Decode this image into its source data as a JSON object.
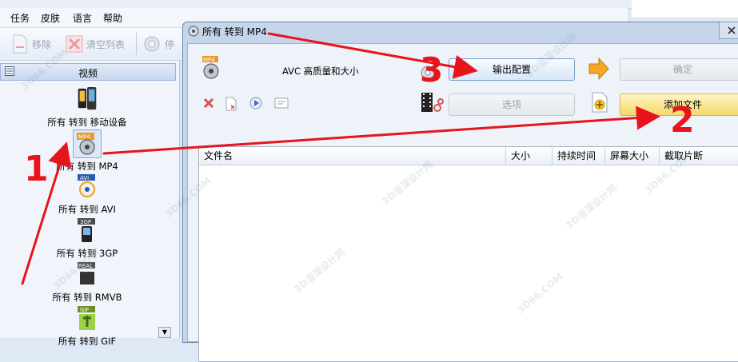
{
  "menu": [
    "任务",
    "皮肤",
    "语言",
    "帮助"
  ],
  "toolbar": {
    "remove": "移除",
    "clear_list": "清空列表",
    "stop": "停"
  },
  "left_panel": {
    "header": "视频",
    "items": [
      {
        "label": "所有 转到 移动设备"
      },
      {
        "label": "所有 转到 MP4",
        "badge": "MP4"
      },
      {
        "label": "所有 转到 AVI",
        "badge": "AVI"
      },
      {
        "label": "所有 转到 3GP",
        "badge": "3GP"
      },
      {
        "label": "所有 转到 RMVB",
        "badge": "REAL"
      },
      {
        "label": "所有 转到 GIF",
        "badge": "GIF"
      }
    ]
  },
  "dialog": {
    "title": "所有 转到 MP4",
    "format_badge": "MP4",
    "profile": "AVC 高质量和大小",
    "buttons": {
      "output_config": "输出配置",
      "ok": "确定",
      "options": "选项",
      "add_file": "添加文件"
    },
    "columns": [
      "文件名",
      "大小",
      "持续时间",
      "屏幕大小",
      "截取片断"
    ]
  },
  "annotations": {
    "step1": "1",
    "step2": "2",
    "step3": "3"
  },
  "watermarks": [
    "3D66.COM",
    "3D溜溜设计网"
  ],
  "colors": {
    "arrow": "#e8141c",
    "accent": "#3b6fb6"
  }
}
